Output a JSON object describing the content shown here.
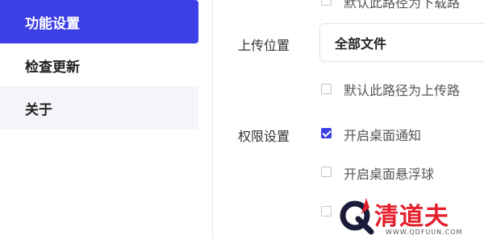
{
  "sidebar": {
    "items": [
      {
        "label": "功能设置",
        "active": true
      },
      {
        "label": "检查更新",
        "active": false
      },
      {
        "label": "关于",
        "active": false
      }
    ]
  },
  "settings": {
    "partial_option_text": "默认此路径为下载路",
    "upload_location": {
      "label": "上传位置",
      "selected": "全部文件",
      "default_path_checkbox": {
        "text": "默认此路径为上传路",
        "checked": false
      }
    },
    "permissions": {
      "label": "权限设置",
      "options": [
        {
          "text": "开启桌面通知",
          "checked": true
        },
        {
          "text": "开启桌面悬浮球",
          "checked": false
        }
      ]
    }
  },
  "watermark": {
    "brand": "清道夫",
    "url": "WWW.QDFUUN.COM"
  },
  "colors": {
    "accent": "#3d3fe6",
    "watermark_red": "#e41e2b"
  }
}
